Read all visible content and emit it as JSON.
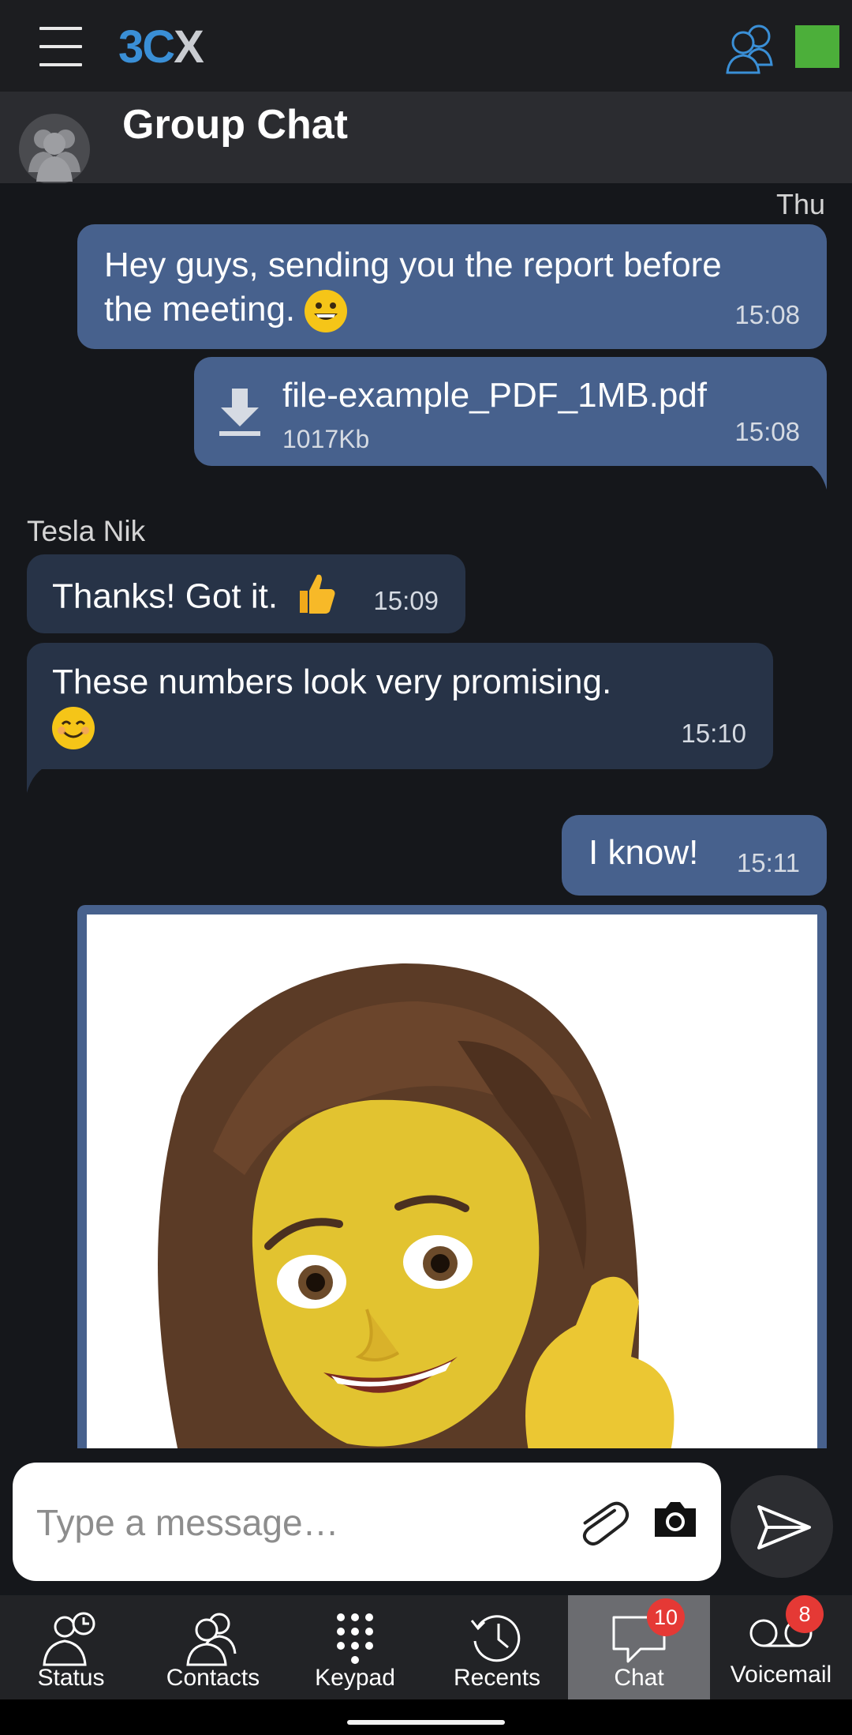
{
  "app": {
    "logo_3": "3",
    "logo_c": "C",
    "logo_x": "X"
  },
  "header": {
    "title": "Group Chat"
  },
  "chat": {
    "day_label": "Thu",
    "messages": [
      {
        "text": "Hey guys, sending you the report before the meeting.",
        "time": "15:08"
      },
      {
        "file_name": "file-example_PDF_1MB.pdf",
        "file_size": "1017Kb",
        "time": "15:08"
      },
      {
        "sender": "Tesla Nik",
        "text": "Thanks! Got it.",
        "time": "15:09"
      },
      {
        "text": "These numbers look very promising.",
        "time": "15:10"
      },
      {
        "text": "I know!",
        "time": "15:11"
      }
    ]
  },
  "composer": {
    "placeholder": "Type a message…"
  },
  "tabs": [
    {
      "label": "Status",
      "icon": "status-icon"
    },
    {
      "label": "Contacts",
      "icon": "contacts-icon"
    },
    {
      "label": "Keypad",
      "icon": "keypad-icon"
    },
    {
      "label": "Recents",
      "icon": "recents-icon"
    },
    {
      "label": "Chat",
      "icon": "chat-icon",
      "badge": "10"
    },
    {
      "label": "Voicemail",
      "icon": "voicemail-icon",
      "badge": "8"
    }
  ],
  "colors": {
    "accent": "#3a8fd6",
    "status": "#4caf3a",
    "outgoing": "#47618d",
    "incoming": "#273347",
    "badge": "#e53935"
  }
}
